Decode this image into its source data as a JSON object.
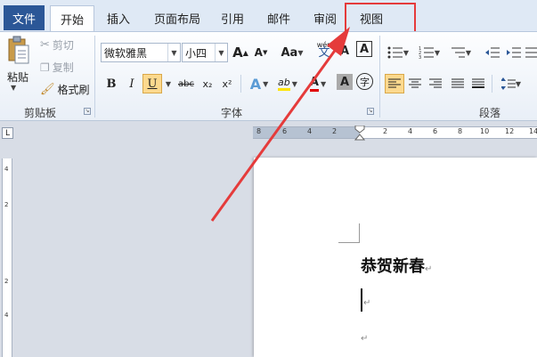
{
  "tabs": {
    "file": "文件",
    "items": [
      "开始",
      "插入",
      "页面布局",
      "引用",
      "邮件",
      "审阅",
      "视图"
    ]
  },
  "clipboard": {
    "paste": "粘贴",
    "cut": "剪切",
    "copy": "复制",
    "format_painter": "格式刷",
    "label": "剪贴板"
  },
  "font": {
    "name": "微软雅黑",
    "size": "小四",
    "grow": "A",
    "shrink": "A",
    "case": "Aa",
    "clear_label": "A",
    "label": "字体",
    "bold": "B",
    "italic": "I",
    "underline": "U",
    "strike": "abc",
    "subscript": "x₂",
    "superscript": "x²",
    "effects": "A",
    "highlight": "ab",
    "color": "A",
    "char_shade": "A",
    "enclose": "字",
    "phonetic": "文",
    "phonetic_top": "wén",
    "border": "A"
  },
  "paragraph": {
    "label": "段落"
  },
  "ruler_h": [
    "8",
    "6",
    "4",
    "2",
    "2",
    "4",
    "6",
    "8",
    "10",
    "12",
    "14"
  ],
  "ruler_v": [
    "4",
    "2",
    "2",
    "4"
  ],
  "document": {
    "title": "恭贺新春",
    "para_mark": "↵"
  },
  "colors": {
    "file_tab": "#2b5797",
    "highlight_box": "#e53b3b",
    "arrow": "#e53b3b"
  }
}
